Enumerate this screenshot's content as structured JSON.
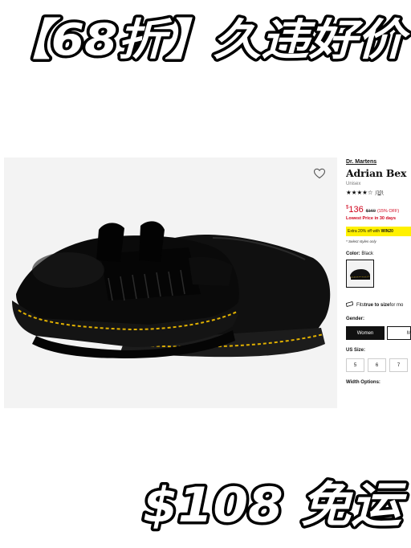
{
  "banner_top": {
    "text": "【68折】久违好价"
  },
  "banner_bottom": {
    "text": "$108 免运"
  },
  "product": {
    "brand": "Dr. Martens",
    "name": "Adrian Bex",
    "gender": "Unisex",
    "stars": "★★★★☆",
    "review_count": "(10)",
    "currency": "$",
    "price": "136",
    "msrp": "$160",
    "discount": "(15% OFF)",
    "lowest_price_note": "Lowest Price in 30 days",
    "promo_prefix": "Extra 20% off with ",
    "promo_code": "WIN20",
    "select_note": "* Select styles only",
    "color_label": "Color:",
    "color_value": "Black",
    "fit_prefix": "Fits ",
    "fit_bold": "true to size",
    "fit_suffix": " for mo",
    "gender_label": "Gender:",
    "gender_options": [
      "Women",
      "M"
    ],
    "size_label": "US Size:",
    "sizes": [
      "5",
      "6",
      "7"
    ],
    "width_label": "Width Options:"
  },
  "colors": {
    "price_red": "#d0021b",
    "promo_yellow": "#fff100",
    "image_bg": "#f3f3f3"
  }
}
